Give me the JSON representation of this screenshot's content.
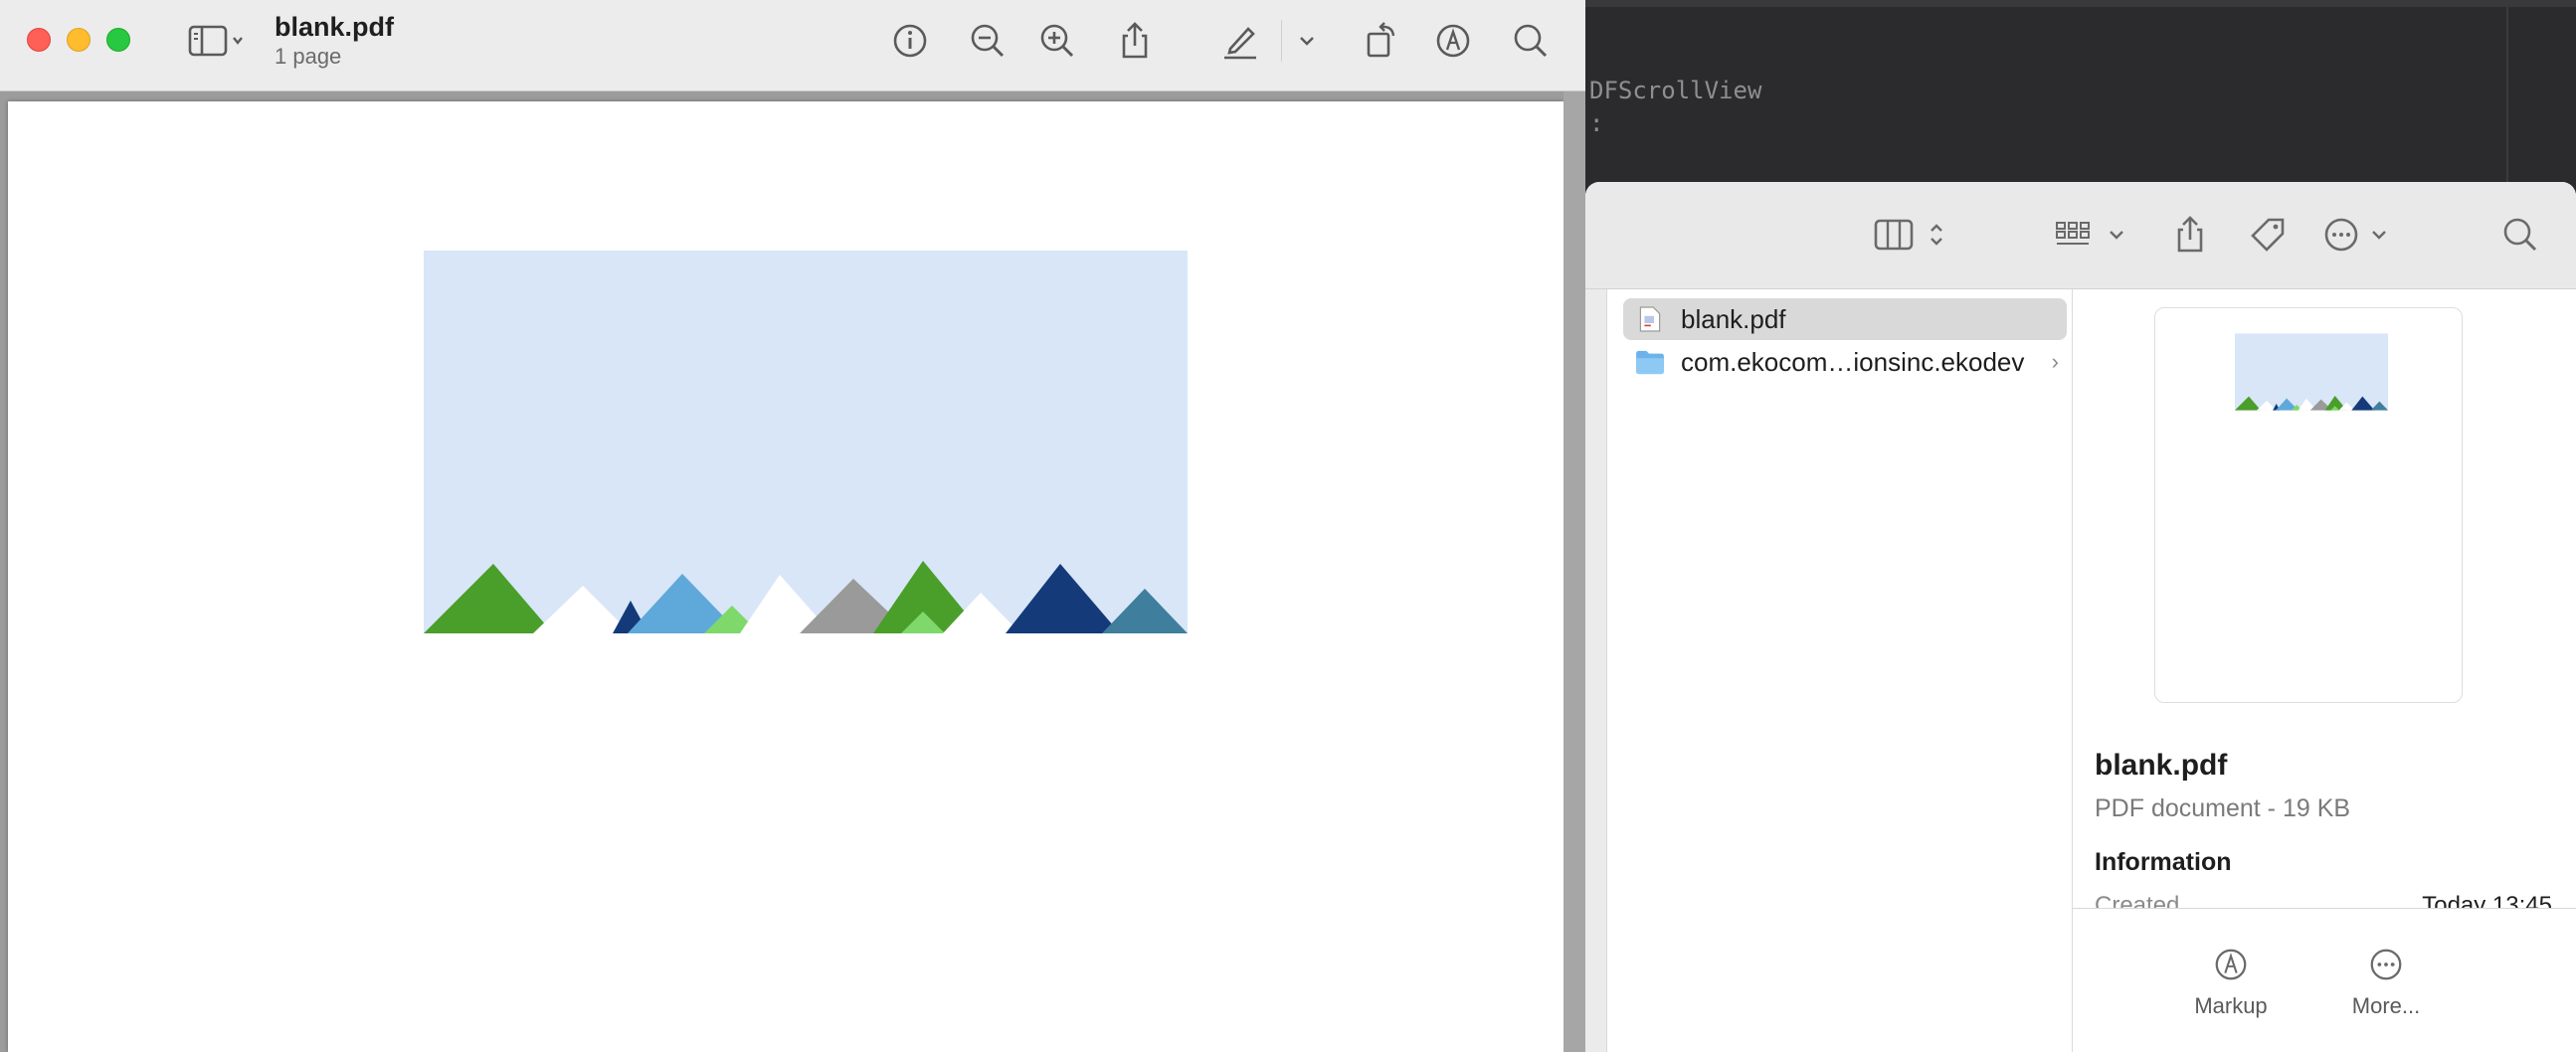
{
  "code_editor": {
    "line1": "DFScrollView",
    "line2": ":"
  },
  "preview": {
    "title": "blank.pdf",
    "subtitle": "1 page",
    "toolbar": {
      "sidebar_icon": "sidebar-icon",
      "info_icon": "info-icon",
      "zoom_out_icon": "zoom-out-icon",
      "zoom_in_icon": "zoom-in-icon",
      "share_icon": "share-icon",
      "highlight_icon": "highlighter-icon",
      "rotate_icon": "rotate-icon",
      "markup_icon": "markup-icon",
      "search_icon": "search-icon"
    },
    "illustration": {
      "sky_color": "#d8e6f7",
      "mountain_colors": [
        "#4a9e2a",
        "#ffffff",
        "#143a7a",
        "#5fa8da",
        "#7ed86a",
        "#9a9a9a",
        "#3f8fb0"
      ]
    }
  },
  "finder": {
    "files": [
      {
        "name": "blank.pdf",
        "selected": true,
        "icon": "pdf-file-icon"
      },
      {
        "name": "com.ekocom…ionsinc.ekodev",
        "selected": false,
        "icon": "folder-icon",
        "has_children": true
      }
    ],
    "preview_pane": {
      "name": "blank.pdf",
      "kind": "PDF document - 19 KB",
      "info_heading": "Information",
      "created_label": "Created",
      "created_value": "Today 13:45",
      "markup_label": "Markup",
      "more_label": "More..."
    }
  }
}
